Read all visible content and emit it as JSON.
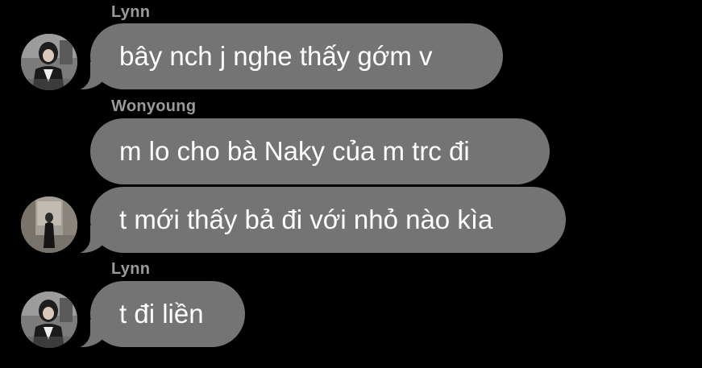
{
  "chat": {
    "messages": [
      {
        "sender": "Lynn",
        "text": "bây nch j nghe thấy gớm v"
      },
      {
        "sender": "Wonyoung",
        "text": "m lo cho bà Naky của m trc đi"
      },
      {
        "sender": "",
        "text": "t mới thấy bả đi với nhỏ nào kìa"
      },
      {
        "sender": "Lynn",
        "text": "t đi liền"
      }
    ]
  },
  "colors": {
    "background": "#000000",
    "bubble": "#747474",
    "sender_name": "#9a9a9a",
    "message_text": "#ffffff"
  },
  "icons": {
    "lynn_avatar": "profile-photo-lynn",
    "wonyoung_avatar": "profile-photo-wonyoung"
  }
}
